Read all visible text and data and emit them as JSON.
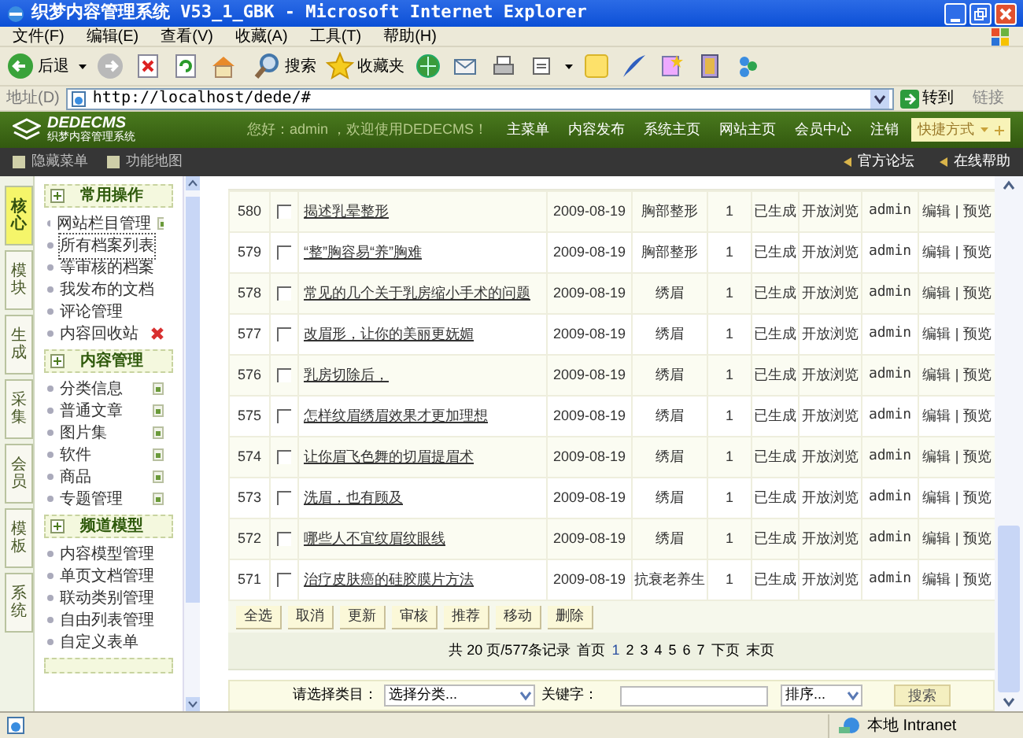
{
  "window": {
    "title": "织梦内容管理系统 V53_1_GBK - Microsoft Internet Explorer"
  },
  "menu": [
    "文件(F)",
    "编辑(E)",
    "查看(V)",
    "收藏(A)",
    "工具(T)",
    "帮助(H)"
  ],
  "toolbar": {
    "back": "后退",
    "search": "搜索",
    "favorites": "收藏夹"
  },
  "address": {
    "label": "地址(D)",
    "url": "http://localhost/dede/#",
    "go": "转到",
    "links": "链接"
  },
  "header": {
    "logo": "DEDECMS",
    "logo_subtitle": "织梦内容管理系统",
    "greeting": "您好：admin ，欢迎使用DEDECMS！",
    "nav": [
      "主菜单",
      "内容发布",
      "系统主页",
      "网站主页",
      "会员中心",
      "注销"
    ],
    "shortcut": "快捷方式"
  },
  "subnav": {
    "left": [
      "隐藏菜单",
      "功能地图"
    ],
    "right": [
      "官方论坛",
      "在线帮助"
    ]
  },
  "side_tabs": [
    {
      "label": "核心",
      "selected": true
    },
    {
      "label": "模块",
      "selected": false
    },
    {
      "label": "生成",
      "selected": false
    },
    {
      "label": "采集",
      "selected": false
    },
    {
      "label": "会员",
      "selected": false
    },
    {
      "label": "模板",
      "selected": false
    },
    {
      "label": "系统",
      "selected": false
    }
  ],
  "sidebar": {
    "sections": [
      {
        "title": "常用操作",
        "items": [
          {
            "label": "网站栏目管理",
            "kind": "add",
            "focused": false
          },
          {
            "label": "所有档案列表",
            "kind": "plain",
            "focused": true
          },
          {
            "label": "等审核的档案",
            "kind": "plain",
            "focused": false
          },
          {
            "label": "我发布的文档",
            "kind": "plain",
            "focused": false
          },
          {
            "label": "评论管理",
            "kind": "plain",
            "focused": false
          },
          {
            "label": "内容回收站",
            "kind": "delete",
            "focused": false
          }
        ]
      },
      {
        "title": "内容管理",
        "items": [
          {
            "label": "分类信息",
            "kind": "add",
            "focused": false
          },
          {
            "label": "普通文章",
            "kind": "add",
            "focused": false
          },
          {
            "label": "图片集",
            "kind": "add",
            "focused": false
          },
          {
            "label": "软件",
            "kind": "add",
            "focused": false
          },
          {
            "label": "商品",
            "kind": "add",
            "focused": false
          },
          {
            "label": "专题管理",
            "kind": "add",
            "focused": false
          }
        ]
      },
      {
        "title": "频道模型",
        "items": [
          {
            "label": "内容模型管理",
            "kind": "plain",
            "focused": false
          },
          {
            "label": "单页文档管理",
            "kind": "plain",
            "focused": false
          },
          {
            "label": "联动类别管理",
            "kind": "plain",
            "focused": false
          },
          {
            "label": "自由列表管理",
            "kind": "plain",
            "focused": false
          },
          {
            "label": "自定义表单",
            "kind": "plain",
            "focused": false
          }
        ]
      }
    ]
  },
  "table": {
    "rows": [
      {
        "id": "580",
        "checked": false,
        "title": "揭述乳晕整形",
        "date": "2009-08-19",
        "category": "胸部整形",
        "clicks": "1",
        "html": "已生成",
        "access": "开放浏览",
        "author": "admin",
        "edit": "编辑",
        "separator": "|",
        "preview": "预览"
      },
      {
        "id": "579",
        "checked": false,
        "title": "“整”胸容易“养”胸难",
        "date": "2009-08-19",
        "category": "胸部整形",
        "clicks": "1",
        "html": "已生成",
        "access": "开放浏览",
        "author": "admin",
        "edit": "编辑",
        "separator": "|",
        "preview": "预览"
      },
      {
        "id": "578",
        "checked": false,
        "title": "常见的几个关于乳房缩小手术的问题",
        "date": "2009-08-19",
        "category": "绣眉",
        "clicks": "1",
        "html": "已生成",
        "access": "开放浏览",
        "author": "admin",
        "edit": "编辑",
        "separator": "|",
        "preview": "预览"
      },
      {
        "id": "577",
        "checked": false,
        "title": "改眉形，让你的美丽更妩媚",
        "date": "2009-08-19",
        "category": "绣眉",
        "clicks": "1",
        "html": "已生成",
        "access": "开放浏览",
        "author": "admin",
        "edit": "编辑",
        "separator": "|",
        "preview": "预览"
      },
      {
        "id": "576",
        "checked": false,
        "title": "乳房切除后，",
        "date": "2009-08-19",
        "category": "绣眉",
        "clicks": "1",
        "html": "已生成",
        "access": "开放浏览",
        "author": "admin",
        "edit": "编辑",
        "separator": "|",
        "preview": "预览"
      },
      {
        "id": "575",
        "checked": false,
        "title": "怎样纹眉绣眉效果才更加理想",
        "date": "2009-08-19",
        "category": "绣眉",
        "clicks": "1",
        "html": "已生成",
        "access": "开放浏览",
        "author": "admin",
        "edit": "编辑",
        "separator": "|",
        "preview": "预览"
      },
      {
        "id": "574",
        "checked": false,
        "title": "让你眉飞色舞的切眉提眉术",
        "date": "2009-08-19",
        "category": "绣眉",
        "clicks": "1",
        "html": "已生成",
        "access": "开放浏览",
        "author": "admin",
        "edit": "编辑",
        "separator": "|",
        "preview": "预览"
      },
      {
        "id": "573",
        "checked": false,
        "title": "洗眉，也有顾及",
        "date": "2009-08-19",
        "category": "绣眉",
        "clicks": "1",
        "html": "已生成",
        "access": "开放浏览",
        "author": "admin",
        "edit": "编辑",
        "separator": "|",
        "preview": "预览"
      },
      {
        "id": "572",
        "checked": false,
        "title": "哪些人不宜纹眉纹眼线",
        "date": "2009-08-19",
        "category": "绣眉",
        "clicks": "1",
        "html": "已生成",
        "access": "开放浏览",
        "author": "admin",
        "edit": "编辑",
        "separator": "|",
        "preview": "预览"
      },
      {
        "id": "571",
        "checked": false,
        "title": "治疗皮肤癌的硅胶膜片方法",
        "date": "2009-08-19",
        "category": "抗衰老养生",
        "clicks": "1",
        "html": "已生成",
        "access": "开放浏览",
        "author": "admin",
        "edit": "编辑",
        "separator": "|",
        "preview": "预览"
      }
    ]
  },
  "actions": [
    "全选",
    "取消",
    "更新",
    "审核",
    "推荐",
    "移动",
    "删除"
  ],
  "pagination": {
    "summary": "共 20 页/577条记录",
    "first": "首页",
    "pages": [
      {
        "label": "1",
        "selected": true
      },
      {
        "label": "2",
        "selected": false
      },
      {
        "label": "3",
        "selected": false
      },
      {
        "label": "4",
        "selected": false
      },
      {
        "label": "5",
        "selected": false
      },
      {
        "label": "6",
        "selected": false
      },
      {
        "label": "7",
        "selected": false
      }
    ],
    "next": "下页",
    "last": "末页"
  },
  "search": {
    "category_label": "请选择类目：",
    "category_value": "选择分类...",
    "keyword_label": "关键字：",
    "order_value": "排序...",
    "button": "搜索"
  },
  "status_bar": {
    "zone": "本地 Intranet"
  }
}
